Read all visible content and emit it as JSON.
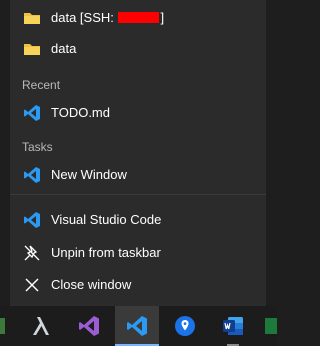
{
  "pinned": [
    {
      "label_prefix": "data [SSH: ",
      "label_suffix": "]",
      "icon": "folder-icon"
    },
    {
      "label": "data",
      "icon": "folder-icon"
    }
  ],
  "recent": {
    "header": "Recent",
    "items": [
      {
        "label": "TODO.md",
        "icon": "vscode-icon"
      }
    ]
  },
  "tasks": {
    "header": "Tasks",
    "items": [
      {
        "label": "New Window",
        "icon": "vscode-icon"
      }
    ]
  },
  "app_actions": [
    {
      "label": "Visual Studio Code",
      "icon": "vscode-icon"
    },
    {
      "label": "Unpin from taskbar",
      "icon": "unpin-icon"
    },
    {
      "label": "Close window",
      "icon": "close-icon"
    }
  ],
  "taskbar": {
    "apps": [
      {
        "name": "lambda-app-icon"
      },
      {
        "name": "visual-studio-icon"
      },
      {
        "name": "vscode-icon",
        "active": true
      },
      {
        "name": "location-app-icon"
      },
      {
        "name": "word-icon"
      }
    ]
  },
  "colors": {
    "menu_bg": "#2b2b2b",
    "taskbar_bg": "#1c1c1c",
    "folder": "#f0c040",
    "vscode_blue": "#2b9af3",
    "redaction": "#ff0000"
  }
}
